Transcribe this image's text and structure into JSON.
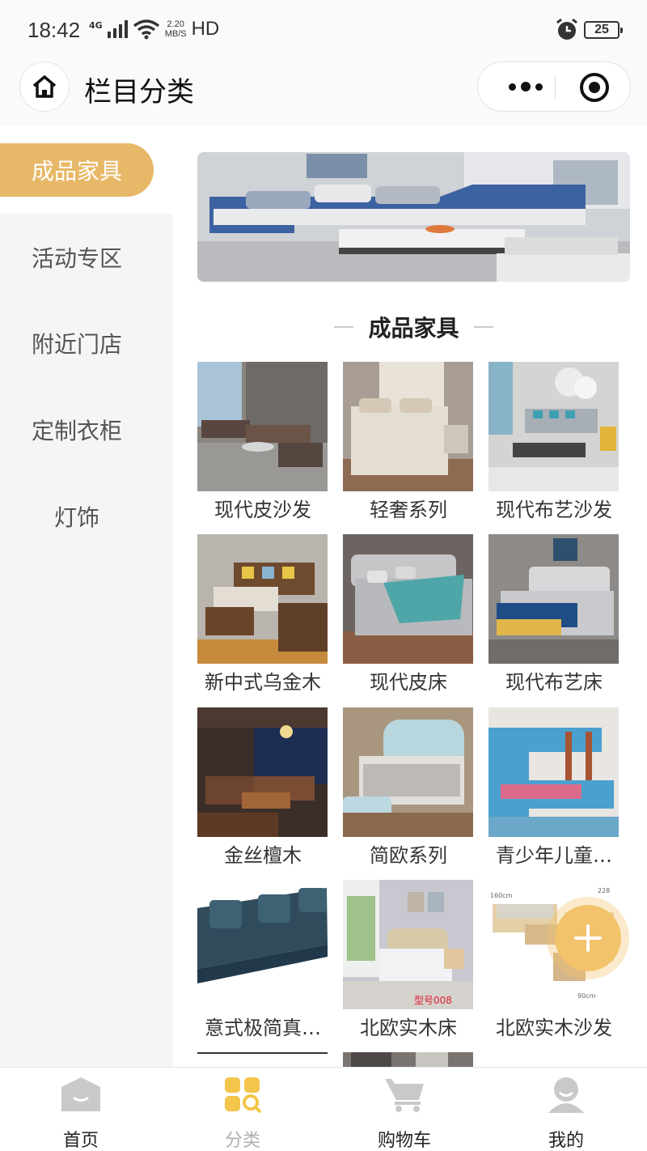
{
  "status_bar": {
    "time": "18:42",
    "network_type": "4G",
    "speed_value": "2.20",
    "speed_unit": "MB/S",
    "hd": "HD",
    "battery": "25"
  },
  "header": {
    "title": "栏目分类"
  },
  "sidebar": {
    "items": [
      {
        "label": "成品家具",
        "active": true
      },
      {
        "label": "活动专区",
        "active": false
      },
      {
        "label": "附近门店",
        "active": false
      },
      {
        "label": "定制衣柜",
        "active": false
      },
      {
        "label": "灯饰",
        "active": false
      }
    ]
  },
  "section": {
    "title": "成品家具"
  },
  "products": [
    {
      "name": "现代皮沙发"
    },
    {
      "name": "轻奢系列"
    },
    {
      "name": "现代布艺沙发"
    },
    {
      "name": "新中式乌金木"
    },
    {
      "name": "现代皮床"
    },
    {
      "name": "现代布艺床"
    },
    {
      "name": "金丝檀木"
    },
    {
      "name": "简欧系列"
    },
    {
      "name": "青少年儿童…"
    },
    {
      "name": "意式极简真…"
    },
    {
      "name": "北欧实木床"
    },
    {
      "name": "北欧实木沙发"
    }
  ],
  "image_marks": {
    "model_number": "型号008",
    "dim_width": "160cm",
    "dim_depth": "90cm",
    "dim_length": "228"
  },
  "tabbar": {
    "items": [
      {
        "label": "首页",
        "icon": "home-icon",
        "active": false
      },
      {
        "label": "分类",
        "icon": "category-icon",
        "active": true
      },
      {
        "label": "购物车",
        "icon": "cart-icon",
        "active": false
      },
      {
        "label": "我的",
        "icon": "profile-icon",
        "active": false
      }
    ]
  },
  "colors": {
    "accent": "#e7b867",
    "fab": "#f2c36b",
    "sidebar_bg": "#f5f5f5",
    "tab_active_icon": "#f3c54a"
  }
}
